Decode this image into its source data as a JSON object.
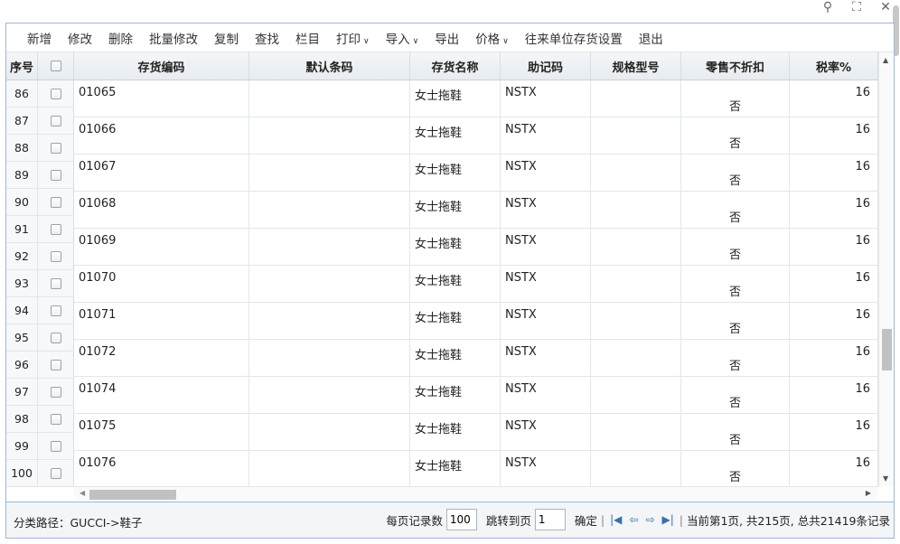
{
  "window": {
    "icons": [
      "search-icon",
      "maximize-icon",
      "close-icon"
    ]
  },
  "toolbar": {
    "buttons": [
      {
        "label": "新增"
      },
      {
        "label": "修改"
      },
      {
        "label": "删除"
      },
      {
        "label": "批量修改"
      },
      {
        "label": "复制"
      },
      {
        "label": "查找"
      },
      {
        "label": "栏目"
      },
      {
        "label": "打印",
        "dropdown": true
      },
      {
        "label": "导入",
        "dropdown": true
      },
      {
        "label": "导出"
      },
      {
        "label": "价格",
        "dropdown": true
      },
      {
        "label": "往来单位存货设置"
      },
      {
        "label": "退出"
      }
    ]
  },
  "grid": {
    "headers": {
      "seq": "序号",
      "code": "存货编码",
      "barcode": "默认条码",
      "name": "存货名称",
      "mnemonic": "助记码",
      "spec": "规格型号",
      "retail": "零售不折扣",
      "tax": "税率%"
    },
    "row_numbers": [
      "86",
      "87",
      "88",
      "89",
      "90",
      "91",
      "92",
      "93",
      "94",
      "95",
      "96",
      "97",
      "98",
      "99",
      "100"
    ],
    "rows": [
      {
        "code": "01065",
        "barcode": "",
        "name": "女士拖鞋",
        "mnemonic": "NSTX",
        "spec": "",
        "retail": "否",
        "tax": "16"
      },
      {
        "code": "01066",
        "barcode": "",
        "name": "女士拖鞋",
        "mnemonic": "NSTX",
        "spec": "",
        "retail": "否",
        "tax": "16"
      },
      {
        "code": "01067",
        "barcode": "",
        "name": "女士拖鞋",
        "mnemonic": "NSTX",
        "spec": "",
        "retail": "否",
        "tax": "16"
      },
      {
        "code": "01068",
        "barcode": "",
        "name": "女士拖鞋",
        "mnemonic": "NSTX",
        "spec": "",
        "retail": "否",
        "tax": "16"
      },
      {
        "code": "01069",
        "barcode": "",
        "name": "女士拖鞋",
        "mnemonic": "NSTX",
        "spec": "",
        "retail": "否",
        "tax": "16"
      },
      {
        "code": "01070",
        "barcode": "",
        "name": "女士拖鞋",
        "mnemonic": "NSTX",
        "spec": "",
        "retail": "否",
        "tax": "16"
      },
      {
        "code": "01071",
        "barcode": "",
        "name": "女士拖鞋",
        "mnemonic": "NSTX",
        "spec": "",
        "retail": "否",
        "tax": "16"
      },
      {
        "code": "01072",
        "barcode": "",
        "name": "女士拖鞋",
        "mnemonic": "NSTX",
        "spec": "",
        "retail": "否",
        "tax": "16"
      },
      {
        "code": "01074",
        "barcode": "",
        "name": "女士拖鞋",
        "mnemonic": "NSTX",
        "spec": "",
        "retail": "否",
        "tax": "16"
      },
      {
        "code": "01075",
        "barcode": "",
        "name": "女士拖鞋",
        "mnemonic": "NSTX",
        "spec": "",
        "retail": "否",
        "tax": "16"
      },
      {
        "code": "01076",
        "barcode": "",
        "name": "女士拖鞋",
        "mnemonic": "NSTX",
        "spec": "",
        "retail": "否",
        "tax": "16"
      }
    ]
  },
  "footer": {
    "path": "分类路径：GUCCI->鞋子",
    "per_page_label": "每页记录数",
    "per_page_value": "100",
    "goto_label": "跳转到页",
    "goto_value": "1",
    "confirm_label": "确定",
    "status": "当前第1页, 共215页, 总共21419条记录"
  }
}
